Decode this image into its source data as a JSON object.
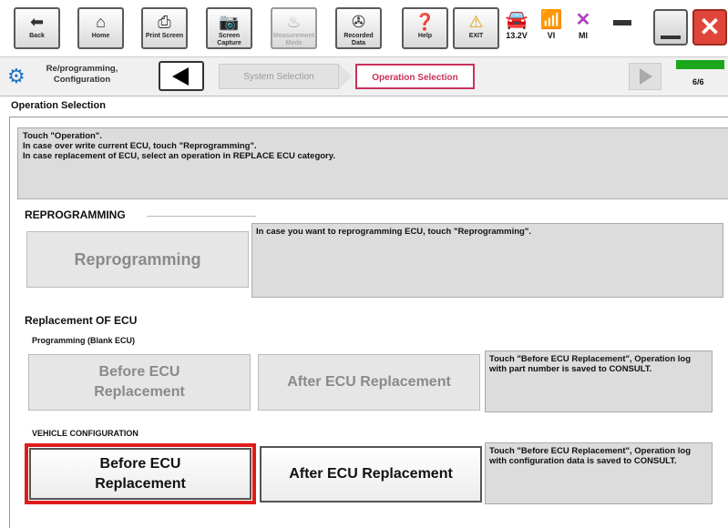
{
  "toolbar": {
    "buttons": [
      {
        "label": "Back",
        "icon": "back-arrow-icon"
      },
      {
        "label": "Home",
        "icon": "home-icon"
      },
      {
        "label": "Print Screen",
        "icon": "printer-icon"
      },
      {
        "label": "Screen Capture",
        "icon": "camera-icon"
      },
      {
        "label": "Measurement Mode",
        "icon": "measurement-icon"
      },
      {
        "label": "Recorded Data",
        "icon": "recorded-data-icon"
      },
      {
        "label": "Help",
        "icon": "help-icon"
      },
      {
        "label": "EXIT",
        "icon": "warning-icon"
      }
    ],
    "voltage": "13.2V",
    "vi_label": "VI",
    "mi_label": "MI"
  },
  "nav": {
    "app_label": "Re/programming, Configuration",
    "system_selection": "System Selection",
    "operation_selection": "Operation Selection",
    "page_counter": "6/6",
    "progress": 1.0
  },
  "section_title": "Operation Selection",
  "instruction": {
    "line1": "Touch \"Operation\".",
    "line2": "In case over write current ECU, touch \"Reprogramming\".",
    "line3": "In case replacement of ECU, select an operation in REPLACE ECU category."
  },
  "reprogramming": {
    "header": "REPROGRAMMING",
    "button": "Reprogramming",
    "note": "In case you want to reprogramming ECU, touch \"Reprogramming\"."
  },
  "replacement": {
    "header": "Replacement OF ECU",
    "blank": {
      "sub": "Programming (Blank ECU)",
      "before": "Before ECU Replacement",
      "after": "After ECU Replacement",
      "note": "Touch \"Before ECU Replacement\", Operation log with part number is saved to CONSULT."
    },
    "vehicle": {
      "sub": "VEHICLE CONFIGURATION",
      "before": "Before ECU Replacement",
      "after": "After ECU Replacement",
      "note": "Touch \"Before ECU Replacement\", Operation log with configuration data is saved to CONSULT."
    }
  },
  "colors": {
    "highlight": "#e01b1b",
    "active_tab_border": "#c8325a",
    "progress": "#1aa81a",
    "close": "#e0453a"
  }
}
